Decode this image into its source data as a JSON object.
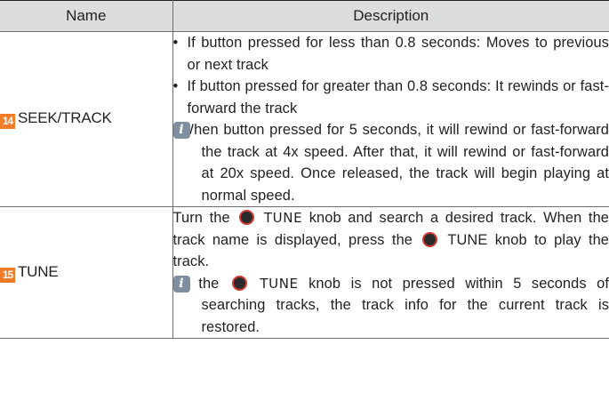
{
  "table": {
    "headers": {
      "name": "Name",
      "description": "Description"
    },
    "rows": [
      {
        "number": "14",
        "name": "SEEK/TRACK",
        "bullets": [
          "If button pressed for less than 0.8 seconds: Moves to previous or next track",
          "If button pressed for greater than 0.8 seconds: It rewinds or fast-forward the track"
        ],
        "note": "When button pressed for 5 seconds, it will rewind or fast-forward the track at 4x speed. After that, it will rewind or fast-forward at 20x speed. Once released, the track will begin playing at normal speed."
      },
      {
        "number": "15",
        "name": "TUNE",
        "text_1": "Turn the",
        "knob_label": "TUNE",
        "text_2": "knob and search a desired track. When the track name is displayed, press the",
        "text_3": "knob to play the track.",
        "note_prefix": "If the",
        "note_suffix": "knob is not pressed within 5 seconds of searching tracks, the track info for the current track is restored."
      }
    ]
  },
  "icons": {
    "bullet": "•",
    "info": "i",
    "knob": "tune-knob-icon"
  },
  "colors": {
    "header_bg": "#dcdddd",
    "badge": "#f07c28",
    "info_icon": "#7f8fa0",
    "knob_ring": "#d03a35"
  }
}
